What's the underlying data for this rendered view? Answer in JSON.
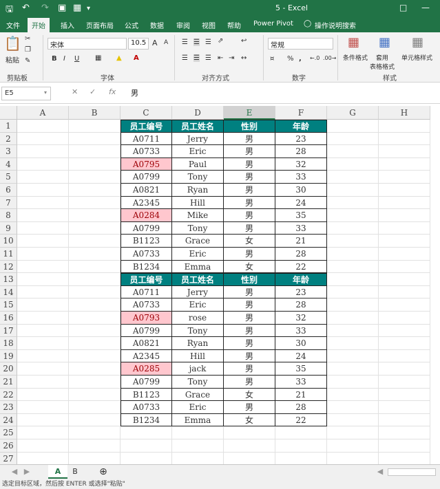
{
  "titlebar": {
    "title": "5  -  Excel",
    "qa_icons": [
      "save-icon",
      "undo-icon",
      "redo-icon",
      "camera-icon",
      "grid-icon",
      "dropdown-icon"
    ],
    "win_icons": [
      "ribbon-display-icon",
      "minimize-icon"
    ]
  },
  "tabs": [
    "文件",
    "开始",
    "插入",
    "页面布局",
    "公式",
    "数据",
    "审阅",
    "视图",
    "帮助",
    "Power Pivot",
    "操作说明搜索"
  ],
  "active_tab": "开始",
  "ribbon": {
    "clipboard": {
      "label": "剪贴板",
      "paste": "粘贴"
    },
    "font": {
      "label": "字体",
      "name": "宋体",
      "size": "10.5",
      "bold": "B",
      "italic": "I",
      "underline": "U",
      "grow": "A",
      "shrink": "A"
    },
    "alignment": {
      "label": "对齐方式"
    },
    "number": {
      "label": "数字",
      "format": "常规",
      "percent": "%"
    },
    "styles": {
      "label": "样式",
      "cond": "条件格式",
      "table": "套用\n表格格式",
      "cell": "单元格样式"
    }
  },
  "formula_bar": {
    "name_box": "E5",
    "fx": "fx",
    "value": "男"
  },
  "columns": [
    "A",
    "B",
    "C",
    "D",
    "E",
    "F",
    "G",
    "H"
  ],
  "rows": [
    "1",
    "2",
    "3",
    "4",
    "5",
    "6",
    "7",
    "8",
    "9",
    "10",
    "11",
    "12",
    "13",
    "14",
    "15",
    "16",
    "17",
    "18",
    "19",
    "20",
    "21",
    "22",
    "23",
    "24",
    "25",
    "26",
    "27"
  ],
  "table": {
    "headers": [
      "员工编号",
      "员工姓名",
      "性别",
      "年龄"
    ],
    "rows": [
      {
        "id": "A0711",
        "name": "Jerry",
        "gender": "男",
        "age": "23",
        "highlight": false
      },
      {
        "id": "A0733",
        "name": "Eric",
        "gender": "男",
        "age": "28",
        "highlight": false
      },
      {
        "id": "A0795",
        "name": "Paul",
        "gender": "男",
        "age": "32",
        "highlight": true
      },
      {
        "id": "A0799",
        "name": "Tony",
        "gender": "男",
        "age": "33",
        "highlight": false
      },
      {
        "id": "A0821",
        "name": "Ryan",
        "gender": "男",
        "age": "30",
        "highlight": false
      },
      {
        "id": "A2345",
        "name": "Hill",
        "gender": "男",
        "age": "24",
        "highlight": false
      },
      {
        "id": "A0284",
        "name": "Mike",
        "gender": "男",
        "age": "35",
        "highlight": true
      },
      {
        "id": "A0799",
        "name": "Tony",
        "gender": "男",
        "age": "33",
        "highlight": false
      },
      {
        "id": "B1123",
        "name": "Grace",
        "gender": "女",
        "age": "21",
        "highlight": false
      },
      {
        "id": "A0733",
        "name": "Eric",
        "gender": "男",
        "age": "28",
        "highlight": false
      },
      {
        "id": "B1234",
        "name": "Emma",
        "gender": "女",
        "age": "22",
        "highlight": false
      }
    ],
    "headers2": [
      "员工编号",
      "员工姓名",
      "性别",
      "年龄"
    ],
    "rows2": [
      {
        "id": "A0711",
        "name": "Jerry",
        "gender": "男",
        "age": "23",
        "highlight": false
      },
      {
        "id": "A0733",
        "name": "Eric",
        "gender": "男",
        "age": "28",
        "highlight": false
      },
      {
        "id": "A0793",
        "name": "rose",
        "gender": "男",
        "age": "32",
        "highlight": true
      },
      {
        "id": "A0799",
        "name": "Tony",
        "gender": "男",
        "age": "33",
        "highlight": false
      },
      {
        "id": "A0821",
        "name": "Ryan",
        "gender": "男",
        "age": "30",
        "highlight": false
      },
      {
        "id": "A2345",
        "name": "Hill",
        "gender": "男",
        "age": "24",
        "highlight": false
      },
      {
        "id": "A0285",
        "name": "jack",
        "gender": "男",
        "age": "35",
        "highlight": true
      },
      {
        "id": "A0799",
        "name": "Tony",
        "gender": "男",
        "age": "33",
        "highlight": false
      },
      {
        "id": "B1123",
        "name": "Grace",
        "gender": "女",
        "age": "21",
        "highlight": false
      },
      {
        "id": "A0733",
        "name": "Eric",
        "gender": "男",
        "age": "28",
        "highlight": false
      },
      {
        "id": "B1234",
        "name": "Emma",
        "gender": "女",
        "age": "22",
        "highlight": false
      }
    ]
  },
  "sheets": [
    "A",
    "B"
  ],
  "active_sheet": "A",
  "status": "选定目标区域，然后按 ENTER 或选择\"粘贴\"",
  "colors": {
    "accent": "#217346",
    "header_fill": "#008080",
    "highlight_fill": "#ffc7ce",
    "highlight_text": "#9c0006"
  }
}
